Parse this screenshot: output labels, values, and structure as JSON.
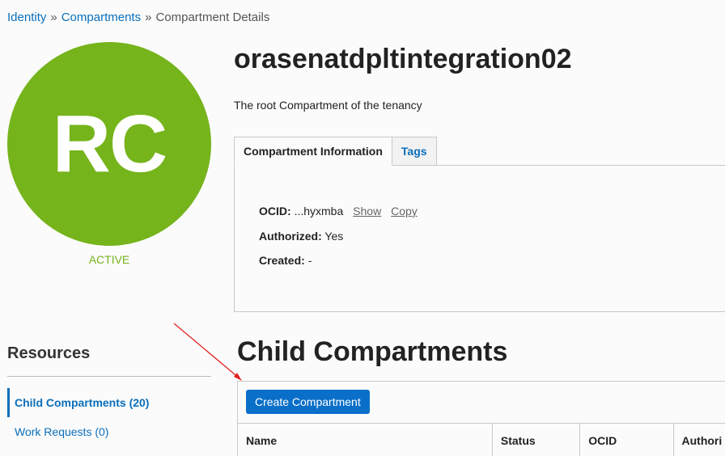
{
  "breadcrumb": {
    "items": [
      "Identity",
      "Compartments"
    ],
    "current": "Compartment Details",
    "separator": "»"
  },
  "avatar": {
    "initials": "RC",
    "state": "ACTIVE",
    "color": "#76b41c"
  },
  "compartment": {
    "name": "orasenatdpltintegration02",
    "description": "The root Compartment of the tenancy"
  },
  "tabs": [
    {
      "label": "Compartment Information",
      "active": true
    },
    {
      "label": "Tags",
      "active": false
    }
  ],
  "info": {
    "ocid_label": "OCID:",
    "ocid_value": "...hyxmba",
    "show_label": "Show",
    "copy_label": "Copy",
    "authorized_label": "Authorized:",
    "authorized_value": "Yes",
    "created_label": "Created:",
    "created_value": "-"
  },
  "resources": {
    "heading": "Resources",
    "items": [
      {
        "label": "Child Compartments (20)",
        "active": true
      },
      {
        "label": "Work Requests (0)",
        "active": false
      }
    ]
  },
  "child_compartments": {
    "heading": "Child Compartments",
    "create_button": "Create Compartment",
    "columns": [
      "Name",
      "Status",
      "OCID",
      "Authori"
    ]
  },
  "colors": {
    "link": "#0a6fbb",
    "primary_button": "#0a6fc9",
    "active_state": "#76b41c",
    "annotation": "#e02020"
  }
}
